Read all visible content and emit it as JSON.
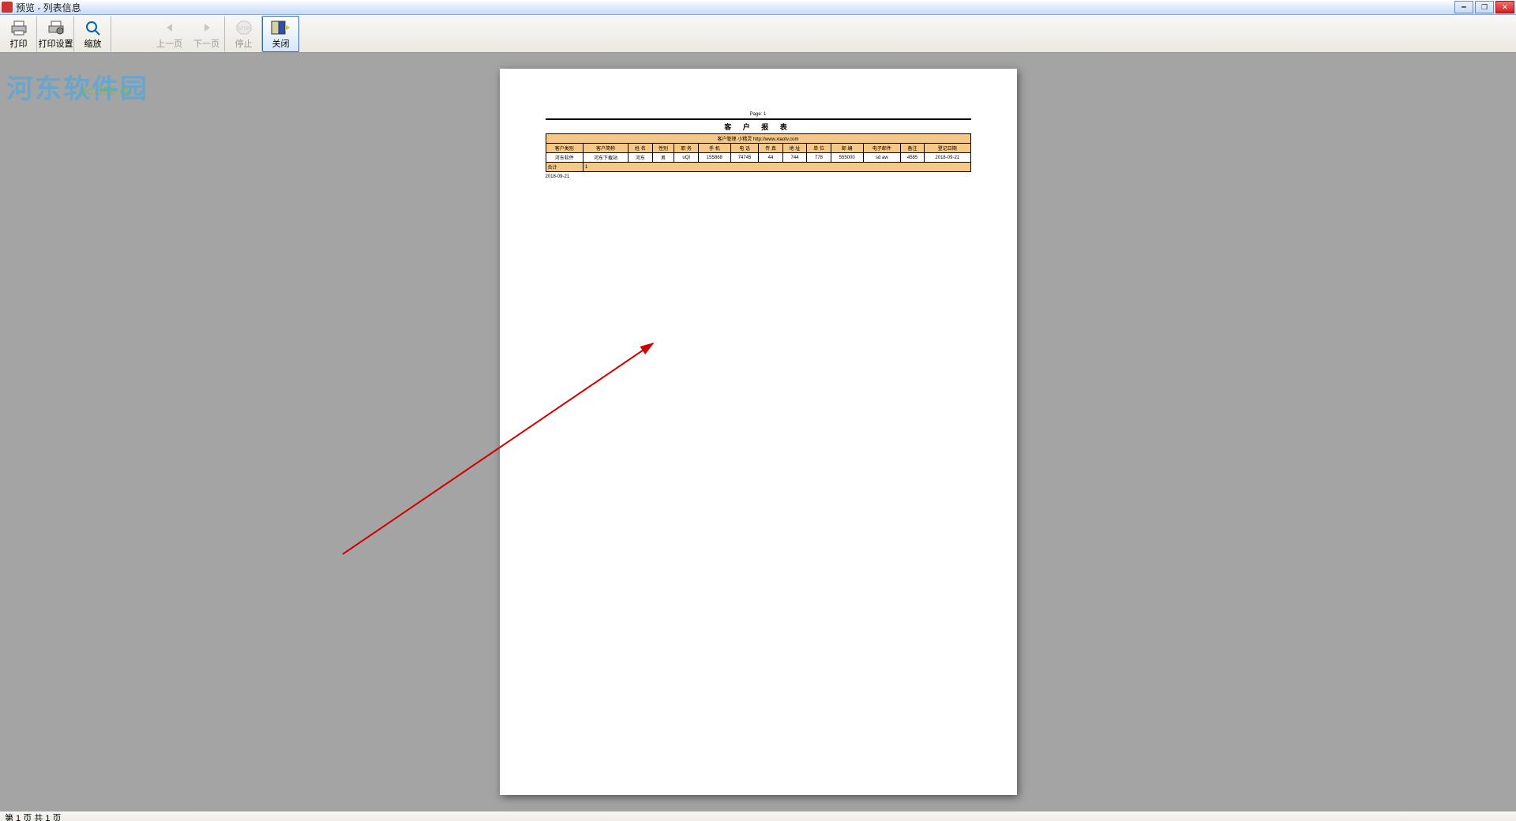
{
  "title": "预览 - 列表信息",
  "watermark": {
    "logo": "河东软件园",
    "url": "pc.059.cn"
  },
  "toolbar": {
    "print": "打印",
    "print_setup": "打印设置",
    "zoom": "缩放",
    "prev": "上一页",
    "next": "下一页",
    "stop": "停止",
    "close": "关闭"
  },
  "report": {
    "page_label": "Page: 1",
    "title": "客 户 报 表",
    "caption": "客户管理 小精灵 http://www.xiaotv.com",
    "columns": [
      "客户类别",
      "客户简称",
      "姓 名",
      "性别",
      "职 务",
      "手 机",
      "电 话",
      "传 真",
      "地 址",
      "单 位",
      "邮 编",
      "电子邮件",
      "备注",
      "登记日期"
    ],
    "rows": [
      [
        "河东软件",
        "河东下载站",
        "河东",
        "男",
        "uQI",
        "155868",
        "74745",
        "44",
        "744",
        "778",
        "555000",
        "sd aw",
        "4585",
        "2018-09-21"
      ]
    ],
    "total_label": "合计",
    "total_value": "1",
    "footer_date": "2018-09-21"
  },
  "status": "第 1 页 共 1 页"
}
